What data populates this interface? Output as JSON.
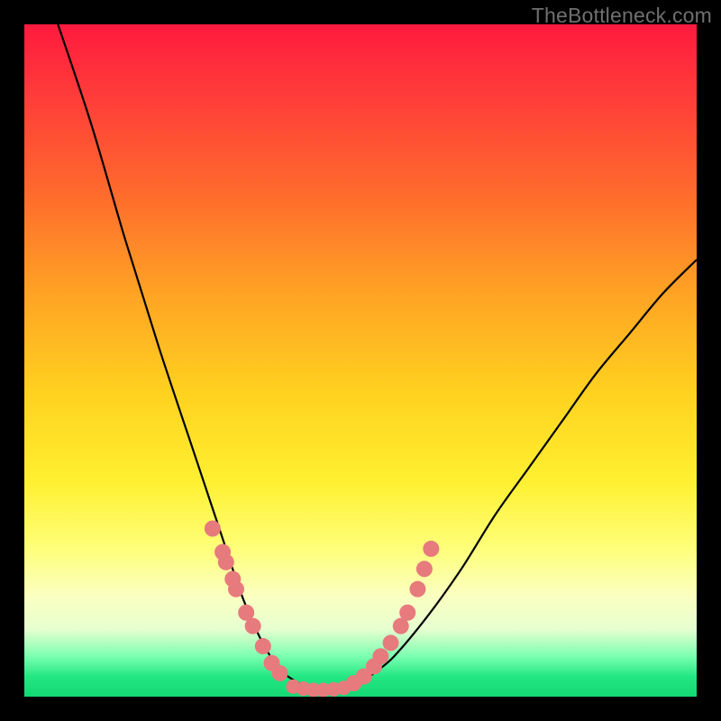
{
  "watermark": "TheBottleneck.com",
  "chart_data": {
    "type": "line",
    "title": "",
    "xlabel": "",
    "ylabel": "",
    "xlim": [
      0,
      100
    ],
    "ylim": [
      0,
      100
    ],
    "background_gradient": {
      "top": "#ff1a3e",
      "upper_mid": "#ffd21f",
      "lower_mid": "#feff7a",
      "bottom": "#13d773"
    },
    "series": [
      {
        "name": "bottleneck-curve",
        "x": [
          5,
          10,
          15,
          20,
          25,
          28,
          30,
          32,
          34,
          36,
          38,
          40,
          42,
          44,
          46,
          48,
          50,
          52,
          55,
          60,
          65,
          70,
          75,
          80,
          85,
          90,
          95,
          100
        ],
        "y": [
          100,
          85,
          68,
          52,
          37,
          28,
          22,
          16,
          11,
          7,
          4,
          2.5,
          1.5,
          1,
          1,
          1.3,
          2,
          3.5,
          6,
          12,
          19,
          27,
          34,
          41,
          48,
          54,
          60,
          65
        ]
      }
    ],
    "dots_left": {
      "name": "left-cluster",
      "x": [
        28.0,
        29.5,
        30.0,
        31.0,
        31.5,
        33.0,
        34.0,
        35.5,
        36.8,
        38.0
      ],
      "y": [
        25.0,
        21.5,
        20.0,
        17.5,
        16.0,
        12.5,
        10.5,
        7.5,
        5.0,
        3.5
      ]
    },
    "dots_right": {
      "name": "right-cluster",
      "x": [
        49.0,
        50.5,
        52.0,
        53.0,
        54.5,
        56.0,
        57.0,
        58.5,
        59.5,
        60.5
      ],
      "y": [
        2.0,
        3.0,
        4.5,
        6.0,
        8.0,
        10.5,
        12.5,
        16.0,
        19.0,
        22.0
      ]
    },
    "dots_bottom": {
      "name": "valley-cluster",
      "x": [
        40.0,
        41.5,
        43.0,
        44.5,
        46.0,
        47.5
      ],
      "y": [
        1.5,
        1.2,
        1.0,
        1.0,
        1.1,
        1.3
      ]
    }
  }
}
